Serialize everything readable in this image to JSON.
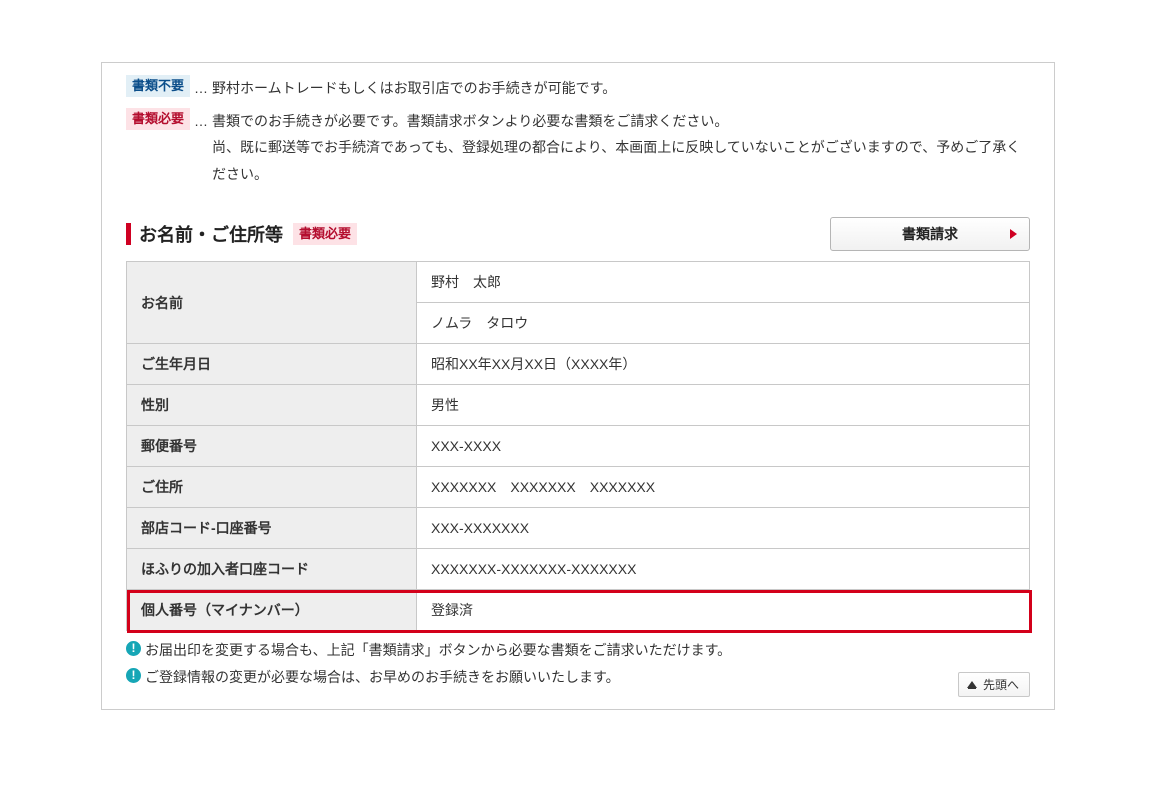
{
  "legend": {
    "not_needed": {
      "badge": "書類不要",
      "text": "野村ホームトレードもしくはお取引店でのお手続きが可能です。"
    },
    "needed": {
      "badge": "書類必要",
      "text1": "書類でのお手続きが必要です。書類請求ボタンより必要な書類をご請求ください。",
      "text2": "尚、既に郵送等でお手続済であっても、登録処理の都合により、本画面上に反映していないことがございますので、予めご了承ください。"
    },
    "sep": "…"
  },
  "section": {
    "title": "お名前・ご住所等",
    "badge": "書類必要",
    "request_button": "書類請求"
  },
  "table": {
    "rows": [
      {
        "label": "お名前",
        "value": "野村　太郎",
        "rowspan": 2
      },
      {
        "label": "",
        "value": "ノムラ　タロウ"
      },
      {
        "label": "ご生年月日",
        "value": "昭和XX年XX月XX日（XXXX年）"
      },
      {
        "label": "性別",
        "value": "男性"
      },
      {
        "label": "郵便番号",
        "value": "XXX-XXXX"
      },
      {
        "label": "ご住所",
        "value": "XXXXXXX　XXXXXXX　XXXXXXX"
      },
      {
        "label": "部店コード-口座番号",
        "value": "XXX-XXXXXXX"
      },
      {
        "label": "ほふりの加入者口座コード",
        "value": "XXXXXXX-XXXXXXX-XXXXXXX"
      },
      {
        "label": "個人番号（マイナンバー）",
        "value": "登録済",
        "highlight": true
      }
    ]
  },
  "notes": {
    "line1": "お届出印を変更する場合も、上記「書類請求」ボタンから必要な書類をご請求いただけます。",
    "line2": "ご登録情報の変更が必要な場合は、お早めのお手続きをお願いいたします。"
  },
  "to_top": "先頭へ",
  "info_glyph": "!"
}
